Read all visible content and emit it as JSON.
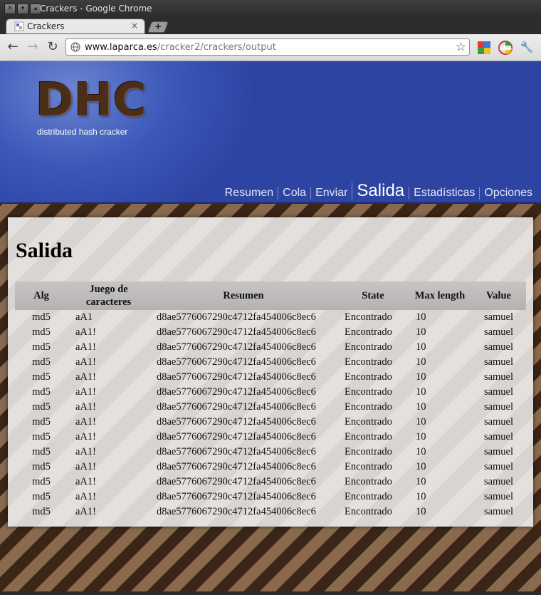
{
  "window": {
    "title": "Crackers - Google Chrome"
  },
  "tab": {
    "title": "Crackers",
    "close": "×",
    "new_tab": "+"
  },
  "toolbar": {
    "back": "←",
    "forward": "→",
    "reload": "↻",
    "url_host": "www.laparca.es",
    "url_path": "/cracker2/crackers/output",
    "star": "☆",
    "wrench": "🔧"
  },
  "header": {
    "logo": "DHC",
    "tagline": "distributed hash cracker",
    "nav": [
      "Resumen",
      "Cola",
      "Enviar",
      "Salida",
      "Estadísticas",
      "Opciones"
    ],
    "active_nav": "Salida"
  },
  "main": {
    "heading": "Salida",
    "columns": [
      "Alg",
      "Juego de caracteres",
      "Resumen",
      "State",
      "Max length",
      "Value"
    ],
    "rows": [
      [
        "md5",
        "aA1",
        "d8ae5776067290c4712fa454006c8ec6",
        "Encontrado",
        "10",
        "samuel"
      ],
      [
        "md5",
        "aA1!",
        "d8ae5776067290c4712fa454006c8ec6",
        "Encontrado",
        "10",
        "samuel"
      ],
      [
        "md5",
        "aA1!",
        "d8ae5776067290c4712fa454006c8ec6",
        "Encontrado",
        "10",
        "samuel"
      ],
      [
        "md5",
        "aA1!",
        "d8ae5776067290c4712fa454006c8ec6",
        "Encontrado",
        "10",
        "samuel"
      ],
      [
        "md5",
        "aA1!",
        "d8ae5776067290c4712fa454006c8ec6",
        "Encontrado",
        "10",
        "samuel"
      ],
      [
        "md5",
        "aA1!",
        "d8ae5776067290c4712fa454006c8ec6",
        "Encontrado",
        "10",
        "samuel"
      ],
      [
        "md5",
        "aA1!",
        "d8ae5776067290c4712fa454006c8ec6",
        "Encontrado",
        "10",
        "samuel"
      ],
      [
        "md5",
        "aA1!",
        "d8ae5776067290c4712fa454006c8ec6",
        "Encontrado",
        "10",
        "samuel"
      ],
      [
        "md5",
        "aA1!",
        "d8ae5776067290c4712fa454006c8ec6",
        "Encontrado",
        "10",
        "samuel"
      ],
      [
        "md5",
        "aA1!",
        "d8ae5776067290c4712fa454006c8ec6",
        "Encontrado",
        "10",
        "samuel"
      ],
      [
        "md5",
        "aA1!",
        "d8ae5776067290c4712fa454006c8ec6",
        "Encontrado",
        "10",
        "samuel"
      ],
      [
        "md5",
        "aA1!",
        "d8ae5776067290c4712fa454006c8ec6",
        "Encontrado",
        "10",
        "samuel"
      ],
      [
        "md5",
        "aA1!",
        "d8ae5776067290c4712fa454006c8ec6",
        "Encontrado",
        "10",
        "samuel"
      ],
      [
        "md5",
        "aA1!",
        "d8ae5776067290c4712fa454006c8ec6",
        "Encontrado",
        "10",
        "samuel"
      ]
    ]
  },
  "colors": {
    "header_blue": "#3a57b9",
    "logo_brown": "#4a2e18"
  }
}
